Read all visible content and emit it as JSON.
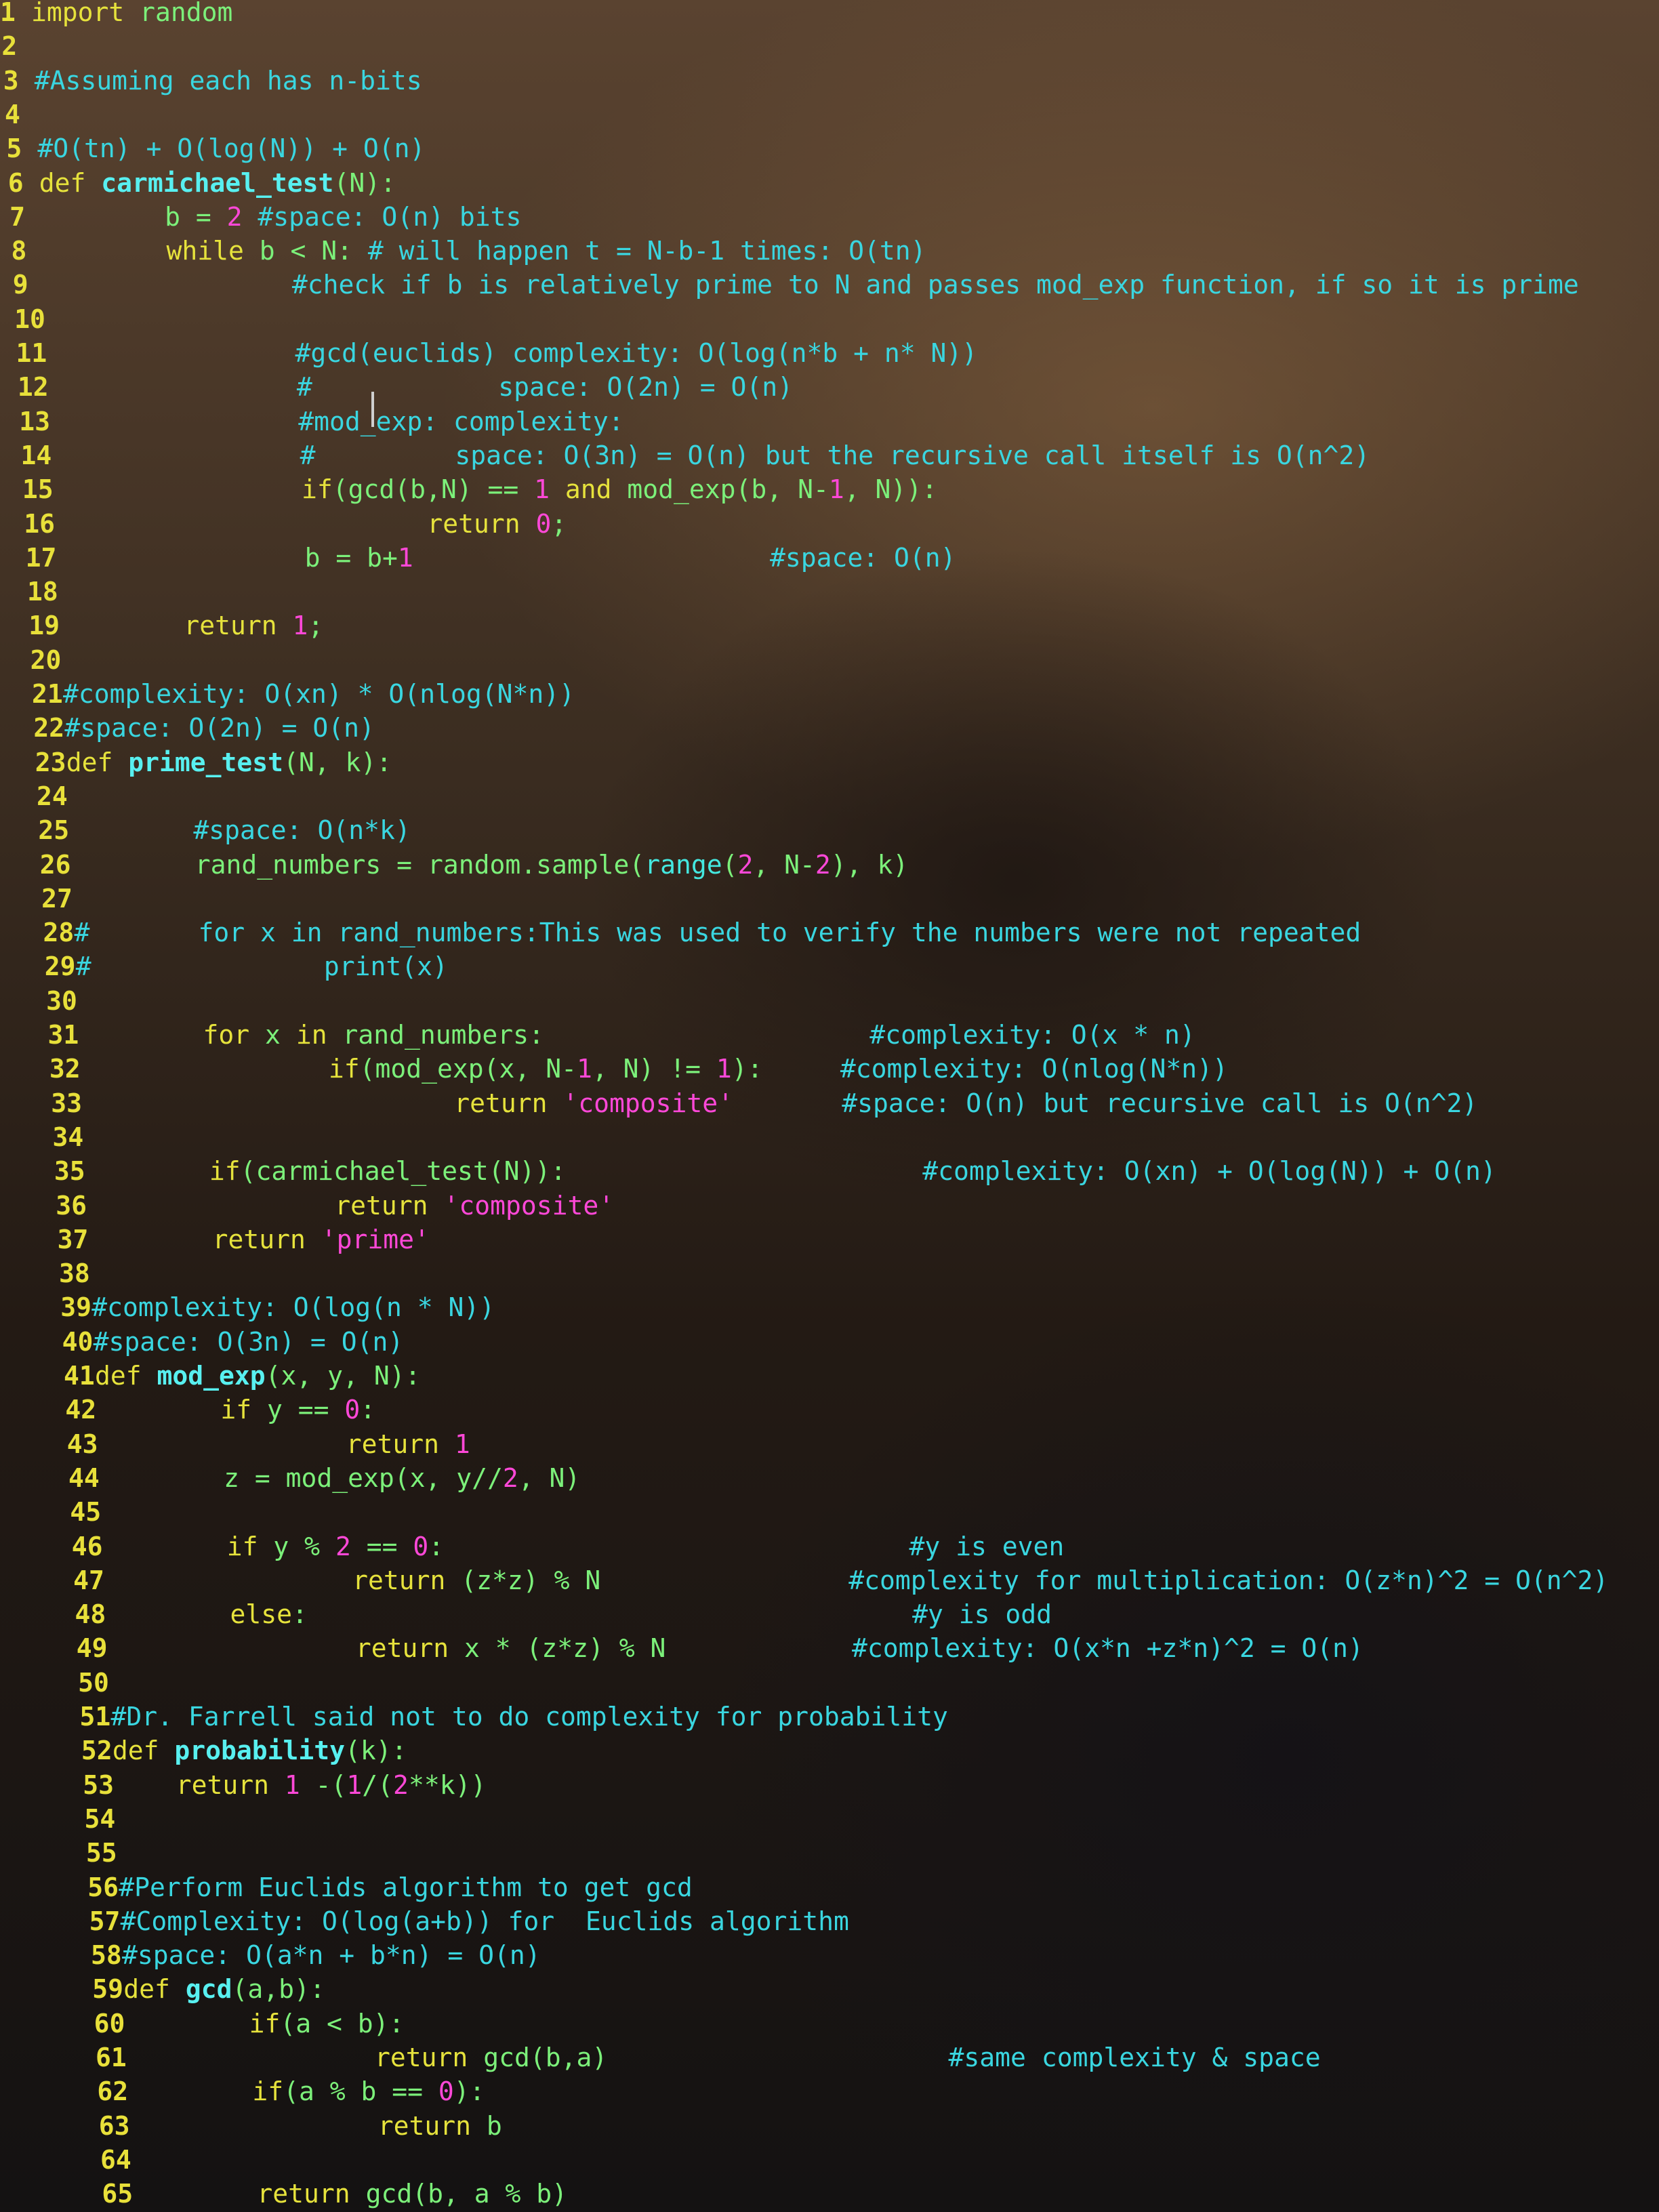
{
  "editor": {
    "lines": [
      {
        "n": "1",
        "segs": [
          [
            "kw",
            "import"
          ],
          [
            "plain",
            " random"
          ]
        ]
      },
      {
        "n": "2",
        "segs": []
      },
      {
        "n": "3",
        "segs": [
          [
            "cm",
            "#Assuming each has n-bits"
          ]
        ]
      },
      {
        "n": "4",
        "segs": []
      },
      {
        "n": "5",
        "segs": [
          [
            "cm",
            "#O(tn) + O(log(N)) + O(n)"
          ]
        ]
      },
      {
        "n": "6",
        "segs": [
          [
            "kw",
            "def "
          ],
          [
            "fn",
            "carmichael_test"
          ],
          [
            "plain",
            "(N):"
          ]
        ]
      },
      {
        "n": "7",
        "segs": [
          [
            "plain",
            "        b = "
          ],
          [
            "num",
            "2"
          ],
          [
            "cm",
            " #space: O(n) bits"
          ]
        ]
      },
      {
        "n": "8",
        "segs": [
          [
            "kw",
            "        while "
          ],
          [
            "plain",
            "b < N: "
          ],
          [
            "cm",
            "# will happen t = N-b-1 times: O(tn)"
          ]
        ]
      },
      {
        "n": "9",
        "segs": [
          [
            "cm",
            "                #check if b is relatively prime to N and passes mod_exp function, if so it is prime"
          ]
        ]
      },
      {
        "n": "10",
        "segs": []
      },
      {
        "n": "11",
        "segs": [
          [
            "cm",
            "                #gcd(euclids) complexity: O(log(n*b + n* N))"
          ]
        ]
      },
      {
        "n": "12",
        "segs": [
          [
            "cm",
            "                #            space: O(2n) = O(n)"
          ]
        ]
      },
      {
        "n": "13",
        "segs": [
          [
            "cm",
            "                #mod_exp: complexity:"
          ]
        ]
      },
      {
        "n": "14",
        "segs": [
          [
            "cm",
            "                #         space: O(3n) = O(n) but the recursive call itself is O(n^2)"
          ]
        ]
      },
      {
        "n": "15",
        "segs": [
          [
            "kw",
            "                if"
          ],
          [
            "plain",
            "(gcd(b,N) == "
          ],
          [
            "num",
            "1"
          ],
          [
            "kw",
            " and "
          ],
          [
            "plain",
            "mod_exp(b, N-"
          ],
          [
            "num",
            "1"
          ],
          [
            "plain",
            ", N)):"
          ]
        ]
      },
      {
        "n": "16",
        "segs": [
          [
            "kw",
            "                        return "
          ],
          [
            "num",
            "0"
          ],
          [
            "plain",
            ";"
          ]
        ]
      },
      {
        "n": "17",
        "segs": [
          [
            "plain",
            "                b = b+"
          ],
          [
            "num",
            "1"
          ],
          [
            "cm",
            "                       #space: O(n)"
          ]
        ]
      },
      {
        "n": "18",
        "segs": []
      },
      {
        "n": "19",
        "segs": [
          [
            "kw",
            "        return "
          ],
          [
            "num",
            "1"
          ],
          [
            "plain",
            ";"
          ]
        ]
      },
      {
        "n": "20",
        "segs": []
      },
      {
        "n": "21",
        "segs": [
          [
            "cm",
            "#complexity: O(xn) * O(nlog(N*n))"
          ]
        ]
      },
      {
        "n": "22",
        "segs": [
          [
            "cm",
            "#space: O(2n) = O(n)"
          ]
        ]
      },
      {
        "n": "23",
        "segs": [
          [
            "kw",
            "def "
          ],
          [
            "fn",
            "prime_test"
          ],
          [
            "plain",
            "(N, k):"
          ]
        ]
      },
      {
        "n": "24",
        "segs": []
      },
      {
        "n": "25",
        "segs": [
          [
            "cm",
            "        #space: O(n*k)"
          ]
        ]
      },
      {
        "n": "26",
        "segs": [
          [
            "plain",
            "        rand_numbers = random.sample("
          ],
          [
            "id",
            "range"
          ],
          [
            "plain",
            "("
          ],
          [
            "num",
            "2"
          ],
          [
            "plain",
            ", N-"
          ],
          [
            "num",
            "2"
          ],
          [
            "plain",
            "), k)"
          ]
        ]
      },
      {
        "n": "27",
        "segs": []
      },
      {
        "n": "28",
        "segs": [
          [
            "cm",
            "#       for x in rand_numbers:This was used to verify the numbers were not repeated"
          ]
        ]
      },
      {
        "n": "29",
        "segs": [
          [
            "cm",
            "#               print(x)"
          ]
        ]
      },
      {
        "n": "30",
        "segs": []
      },
      {
        "n": "31",
        "segs": [
          [
            "kw",
            "        for "
          ],
          [
            "plain",
            "x "
          ],
          [
            "kw",
            "in "
          ],
          [
            "plain",
            "rand_numbers:"
          ],
          [
            "cm",
            "                     #complexity: O(x * n)"
          ]
        ]
      },
      {
        "n": "32",
        "segs": [
          [
            "kw",
            "                if"
          ],
          [
            "plain",
            "(mod_exp(x, N-"
          ],
          [
            "num",
            "1"
          ],
          [
            "plain",
            ", N) != "
          ],
          [
            "num",
            "1"
          ],
          [
            "plain",
            "):"
          ],
          [
            "cm",
            "     #complexity: O(nlog(N*n))"
          ]
        ]
      },
      {
        "n": "33",
        "segs": [
          [
            "kw",
            "                        return "
          ],
          [
            "str",
            "'composite'"
          ],
          [
            "cm",
            "       #space: O(n) but recursive call is O(n^2)"
          ]
        ]
      },
      {
        "n": "34",
        "segs": []
      },
      {
        "n": "35",
        "segs": [
          [
            "kw",
            "        if"
          ],
          [
            "plain",
            "(carmichael_test(N)):"
          ],
          [
            "cm",
            "                       #complexity: O(xn) + O(log(N)) + O(n)"
          ]
        ]
      },
      {
        "n": "36",
        "segs": [
          [
            "kw",
            "                return "
          ],
          [
            "str",
            "'composite'"
          ]
        ]
      },
      {
        "n": "37",
        "segs": [
          [
            "kw",
            "        return "
          ],
          [
            "str",
            "'prime'"
          ]
        ]
      },
      {
        "n": "38",
        "segs": []
      },
      {
        "n": "39",
        "segs": [
          [
            "cm",
            "#complexity: O(log(n * N))"
          ]
        ]
      },
      {
        "n": "40",
        "segs": [
          [
            "cm",
            "#space: O(3n) = O(n)"
          ]
        ]
      },
      {
        "n": "41",
        "segs": [
          [
            "kw",
            "def "
          ],
          [
            "fn",
            "mod_exp"
          ],
          [
            "plain",
            "(x, y, N):"
          ]
        ]
      },
      {
        "n": "42",
        "segs": [
          [
            "kw",
            "        if "
          ],
          [
            "plain",
            "y == "
          ],
          [
            "num",
            "0"
          ],
          [
            "plain",
            ":"
          ]
        ]
      },
      {
        "n": "43",
        "segs": [
          [
            "kw",
            "                return "
          ],
          [
            "num",
            "1"
          ]
        ]
      },
      {
        "n": "44",
        "segs": [
          [
            "plain",
            "        z = mod_exp(x, y//"
          ],
          [
            "num",
            "2"
          ],
          [
            "plain",
            ", N)"
          ]
        ]
      },
      {
        "n": "45",
        "segs": []
      },
      {
        "n": "46",
        "segs": [
          [
            "kw",
            "        if "
          ],
          [
            "plain",
            "y % "
          ],
          [
            "num",
            "2"
          ],
          [
            "plain",
            " == "
          ],
          [
            "num",
            "0"
          ],
          [
            "plain",
            ":"
          ],
          [
            "cm",
            "                              #y is even"
          ]
        ]
      },
      {
        "n": "47",
        "segs": [
          [
            "kw",
            "                return "
          ],
          [
            "plain",
            "(z*z) % N"
          ],
          [
            "cm",
            "                #complexity for multiplication: O(z*n)^2 = O(n^2)"
          ]
        ]
      },
      {
        "n": "48",
        "segs": [
          [
            "kw",
            "        else"
          ],
          [
            "plain",
            ":"
          ],
          [
            "cm",
            "                                       #y is odd"
          ]
        ]
      },
      {
        "n": "49",
        "segs": [
          [
            "kw",
            "                return "
          ],
          [
            "plain",
            "x * (z*z) % N"
          ],
          [
            "cm",
            "            #complexity: O(x*n +z*n)^2 = O(n)"
          ]
        ]
      },
      {
        "n": "50",
        "segs": []
      },
      {
        "n": "51",
        "segs": [
          [
            "cm",
            "#Dr. Farrell said not to do complexity for probability"
          ]
        ]
      },
      {
        "n": "52",
        "segs": [
          [
            "kw",
            "def "
          ],
          [
            "fn",
            "probability"
          ],
          [
            "plain",
            "(k):"
          ]
        ]
      },
      {
        "n": "53",
        "segs": [
          [
            "kw",
            "    return "
          ],
          [
            "num",
            "1"
          ],
          [
            "plain",
            " -("
          ],
          [
            "num",
            "1"
          ],
          [
            "plain",
            "/("
          ],
          [
            "num",
            "2"
          ],
          [
            "plain",
            "**k))"
          ]
        ]
      },
      {
        "n": "54",
        "segs": []
      },
      {
        "n": "55",
        "segs": []
      },
      {
        "n": "56",
        "segs": [
          [
            "cm",
            "#Perform Euclids algorithm to get gcd"
          ]
        ]
      },
      {
        "n": "57",
        "segs": [
          [
            "cm",
            "#Complexity: O(log(a+b)) for  Euclids algorithm"
          ]
        ]
      },
      {
        "n": "58",
        "segs": [
          [
            "cm",
            "#space: O(a*n + b*n) = O(n)"
          ]
        ]
      },
      {
        "n": "59",
        "segs": [
          [
            "kw",
            "def "
          ],
          [
            "fn",
            "gcd"
          ],
          [
            "plain",
            "(a,b):"
          ]
        ]
      },
      {
        "n": "60",
        "segs": [
          [
            "kw",
            "        if"
          ],
          [
            "plain",
            "(a < b):"
          ]
        ]
      },
      {
        "n": "61",
        "segs": [
          [
            "kw",
            "                return "
          ],
          [
            "plain",
            "gcd(b,a)"
          ],
          [
            "cm",
            "                      #same complexity & space"
          ]
        ]
      },
      {
        "n": "62",
        "segs": [
          [
            "kw",
            "        if"
          ],
          [
            "plain",
            "(a % b == "
          ],
          [
            "num",
            "0"
          ],
          [
            "plain",
            "):"
          ]
        ]
      },
      {
        "n": "63",
        "segs": [
          [
            "kw",
            "                return "
          ],
          [
            "plain",
            "b"
          ]
        ]
      },
      {
        "n": "64",
        "segs": []
      },
      {
        "n": "65",
        "segs": [
          [
            "kw",
            "        return "
          ],
          [
            "plain",
            "gcd(b, a % b)"
          ]
        ]
      }
    ]
  }
}
